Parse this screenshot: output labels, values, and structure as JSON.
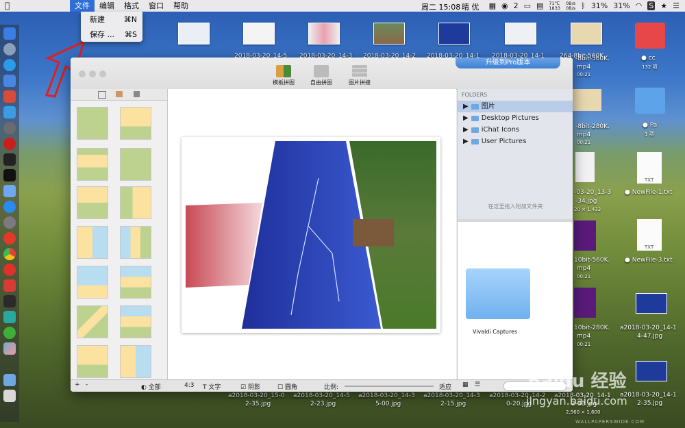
{
  "menubar": {
    "items": [
      "文件",
      "编辑",
      "格式",
      "窗口",
      "帮助"
    ],
    "notif_count": "2",
    "temp": "71℃",
    "fan": "1833",
    "net_up": "0B/s",
    "net_down": "0B/s",
    "datetime": "周二 15:08",
    "weather_label": "晴 优",
    "battery1": "31%",
    "battery2": "31%"
  },
  "dropdown": [
    {
      "label": "新建",
      "shortcut": "⌘N"
    },
    {
      "label": "保存 ...",
      "shortcut": "⌘S"
    }
  ],
  "toolbar": {
    "buttons": [
      "模板拼图",
      "自由拼图",
      "图片拼接"
    ],
    "pro_label": "升级到Pro版本"
  },
  "folders": {
    "header": "FOLDERS",
    "items": [
      "图片",
      "Desktop Pictures",
      "iChat Icons",
      "User Pictures"
    ],
    "drop_hint": "在这里拖入附加文件夹",
    "folder_name": "Vivaldi Captures"
  },
  "status": {
    "all": "全部",
    "ratio": "4:3",
    "text": "文字",
    "shadow": "阴影",
    "round": "圆角",
    "scale_label": "比例:",
    "fit": "适应"
  },
  "desktop": {
    "bottom_files": [
      {
        "name": "a2018-03-20_15-0",
        "sub": "2-35.jpg"
      },
      {
        "name": "a2018-03-20_14-5",
        "sub": "2-23.jpg"
      },
      {
        "name": "a2018-03-20_14-3",
        "sub": "5-00.jpg"
      },
      {
        "name": "a2018-03-20_14-3",
        "sub": "2-15.jpg"
      },
      {
        "name": "a2018-03-20_14-2",
        "sub": "0-20.jpg"
      },
      {
        "name": "a2018-03-20_14-1",
        "sub": "2-33.jpg"
      },
      {
        "name": "a2018-03-20_14-1",
        "sub": "2-26.jpg"
      }
    ],
    "bottom_dims": "2,560 × 1,600",
    "right_items": [
      {
        "name": "cc",
        "sub": "132 项"
      },
      {
        "name": "Pa",
        "sub": "1 项"
      },
      {
        "name": "NewFile-1.txt",
        "sub": ""
      },
      {
        "name": "NewFile-3.txt",
        "sub": ""
      },
      {
        "name": "a2018-03-20_14-1",
        "sub": "4-47.jpg"
      },
      {
        "name": "a2018-03-20_14-1",
        "sub": "2-35.jpg"
      }
    ],
    "mid_items": [
      {
        "name": "-8bit-560K.",
        "sub": "mp4",
        "meta": "00:21"
      },
      {
        "name": "-8bit-280K.",
        "sub": "mp4",
        "meta": "00:21"
      },
      {
        "name": "-03-20_13-3",
        "sub": "-34.jpg",
        "meta": "20 × 1,432"
      },
      {
        "name": "10bit-560K.",
        "sub": "mp4",
        "meta": "00:21"
      },
      {
        "name": "10bit-280K.",
        "sub": "mp4",
        "meta": "00:21"
      }
    ],
    "txt_label": "TXT",
    "top_partial": [
      "2018-03-20_14-5",
      "2018-03-20_14-3",
      "2018-03-20_14-2",
      "2018-03-20_14-1",
      "2018-03-20_14-1",
      "264-8bit-560K."
    ]
  },
  "watermark": {
    "brand": "Baidu 经验",
    "url": "jingyan.baidu.com",
    "site": "WALLPAPERSWIDE.COM"
  }
}
